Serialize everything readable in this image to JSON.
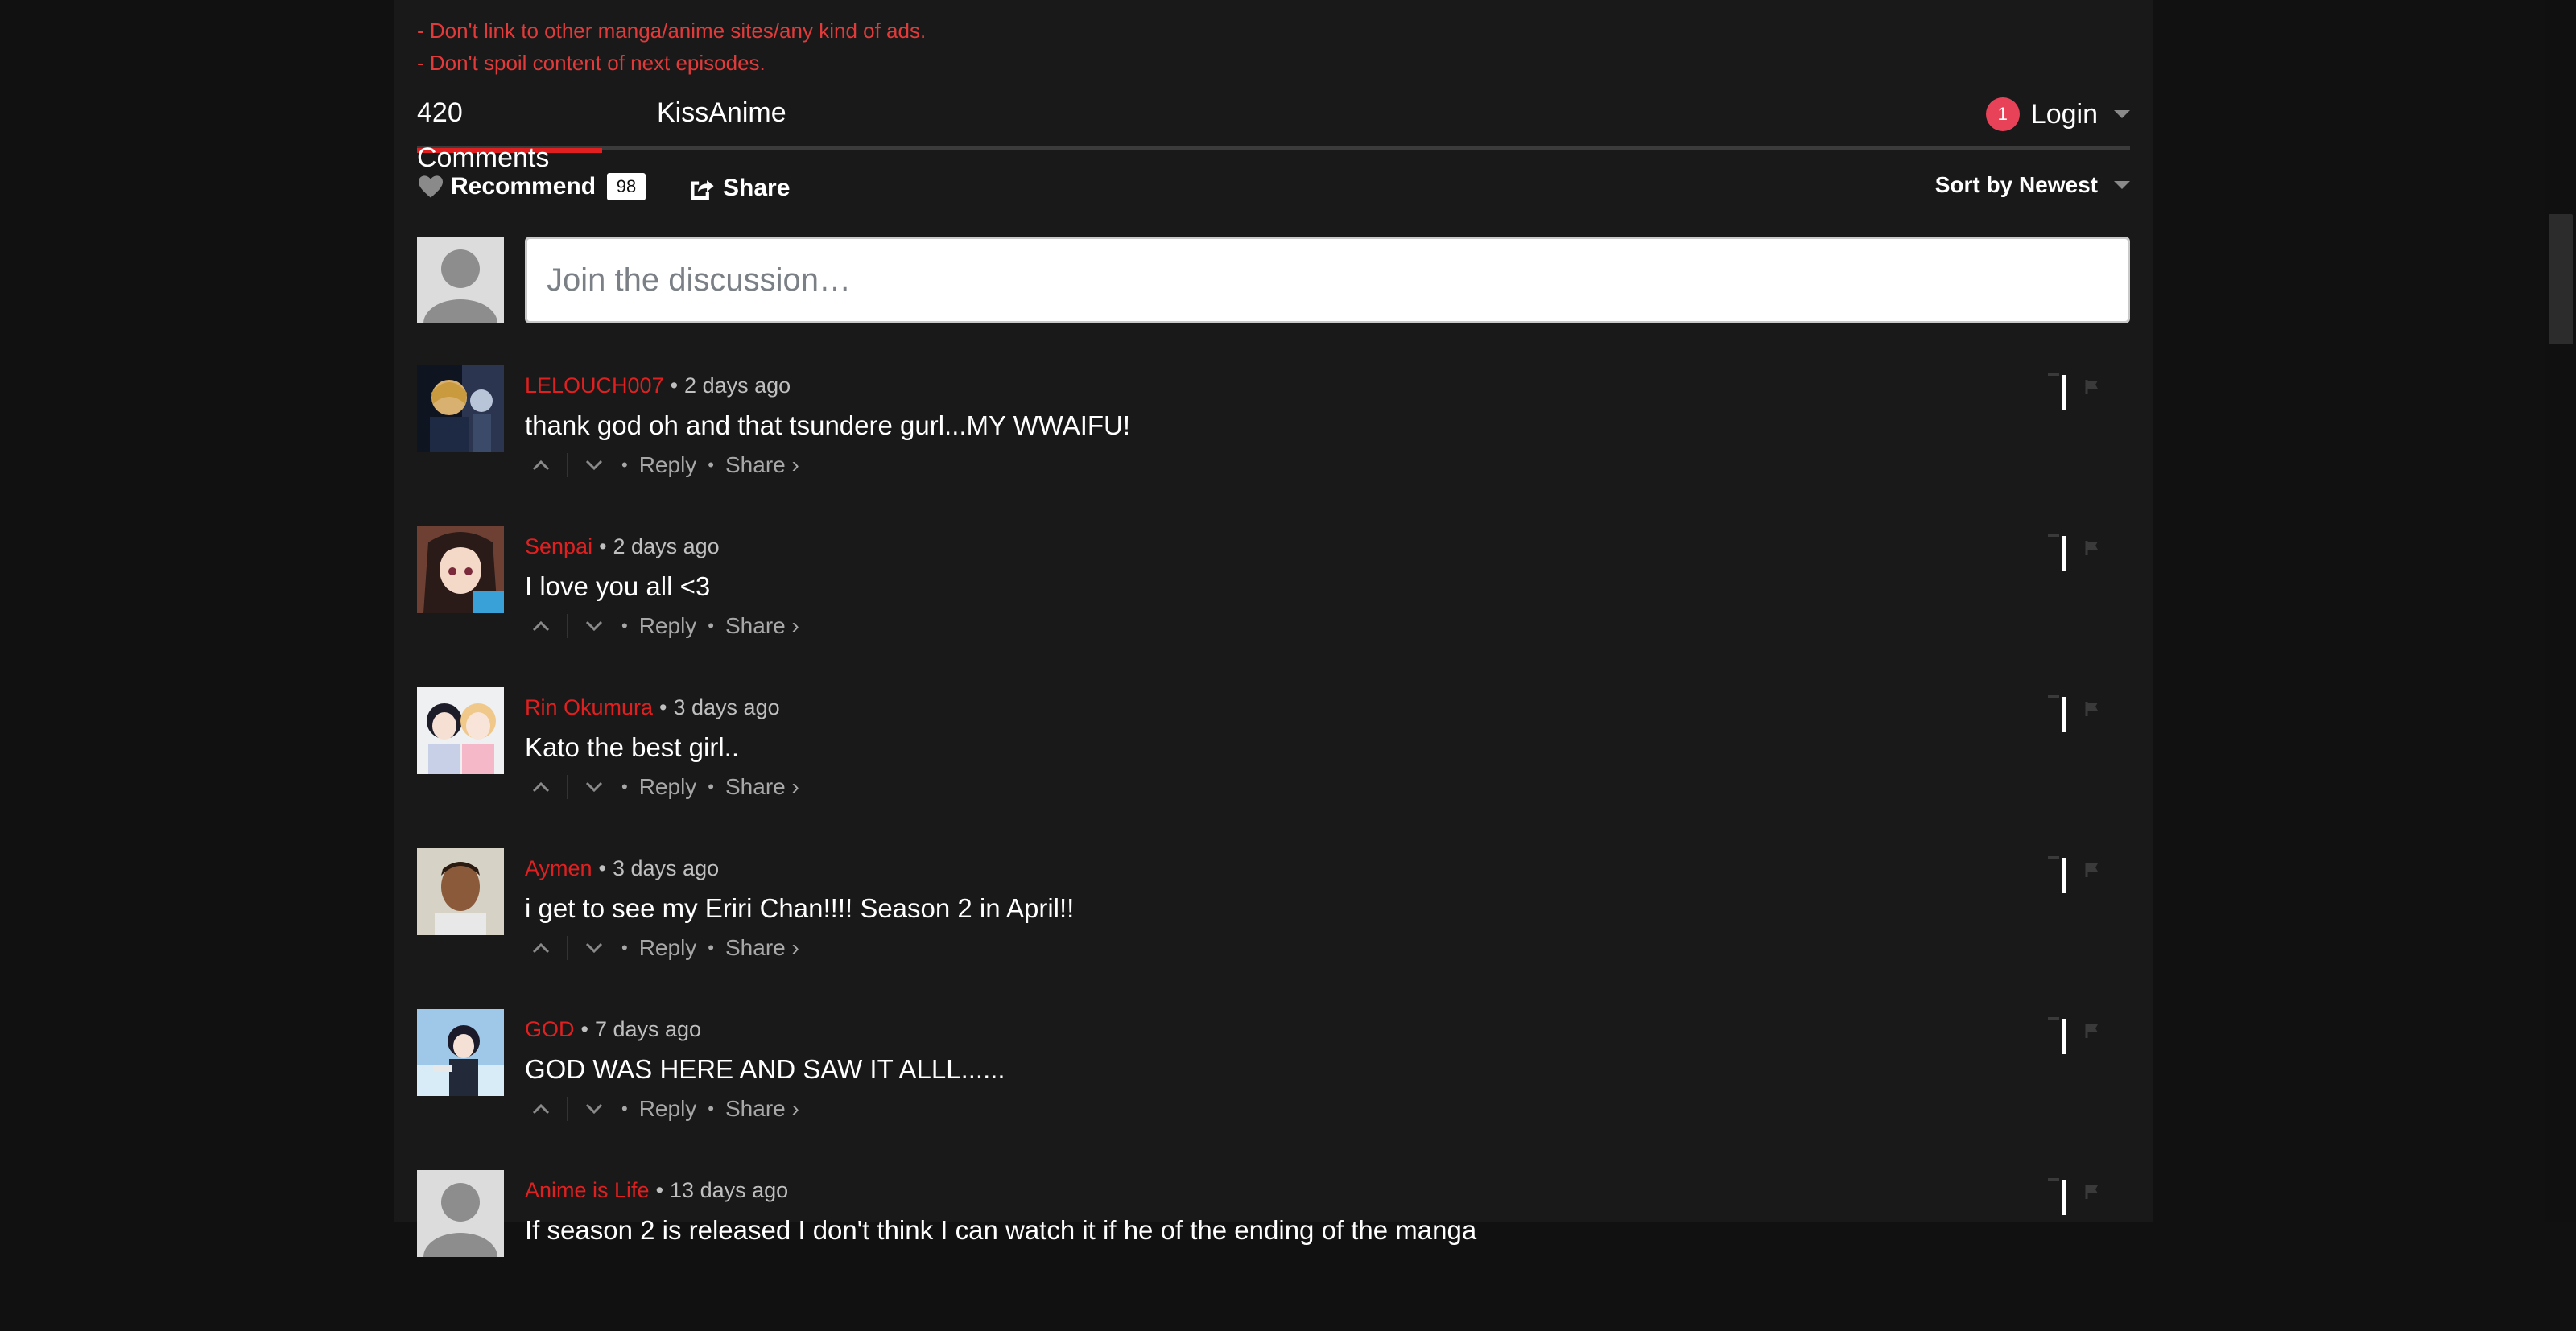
{
  "rules": [
    "- Don't link to other manga/anime sites/any kind of ads.",
    "- Don't spoil content of next episodes."
  ],
  "nav": {
    "comments_tab": "420 Comments",
    "site_tab": "KissAnime",
    "notification_count": "1",
    "login_label": "Login"
  },
  "actions": {
    "recommend_label": "Recommend",
    "recommend_count": "98",
    "share_label": "Share",
    "sort_label": "Sort by Newest"
  },
  "composer": {
    "placeholder": "Join the discussion…"
  },
  "comment_labels": {
    "reply": "Reply",
    "share": "Share ›",
    "dot": "•"
  },
  "comments": [
    {
      "author": "LELOUCH007",
      "time": "2 days ago",
      "text": "thank god oh and that tsundere gurl...MY WWAIFU!",
      "avatar": "anime-character-avatar"
    },
    {
      "author": "Senpai",
      "time": "2 days ago",
      "text": "I love you all <3",
      "avatar": "anime-girl-avatar"
    },
    {
      "author": "Rin Okumura",
      "time": "3 days ago",
      "text": "Kato the best girl..",
      "avatar": "anime-duo-avatar"
    },
    {
      "author": "Aymen",
      "time": "3 days ago",
      "text": "i get to see my Eriri Chan!!!! Season 2 in April!!",
      "avatar": "photo-avatar"
    },
    {
      "author": "GOD",
      "time": "7 days ago",
      "text": "GOD WAS HERE AND SAW IT ALLL......",
      "avatar": "anime-boy-avatar"
    },
    {
      "author": "Anime is Life",
      "time": "13 days ago",
      "text": "If season 2 is released I don't think I can watch it if he of the ending of the manga",
      "avatar": "default-avatar"
    }
  ],
  "colors": {
    "accent": "#e02020",
    "page_bg": "#111111",
    "panel_bg": "#191919",
    "badge": "#e84258"
  }
}
